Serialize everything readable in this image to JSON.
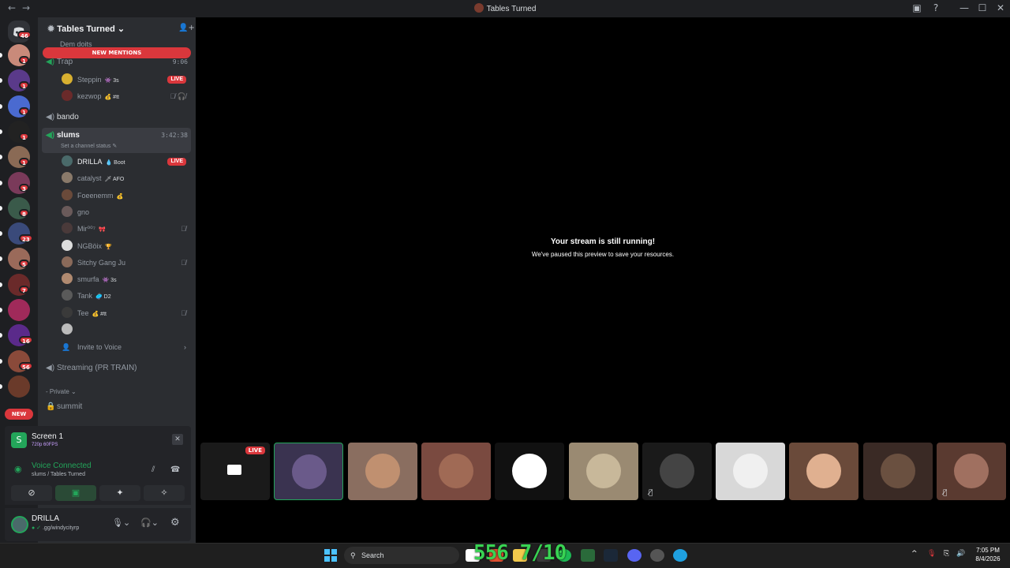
{
  "window": {
    "title": "Tables Turned",
    "back_glyph": "←",
    "forward_glyph": "→",
    "controls": [
      "▣",
      "?",
      "—",
      "☐",
      "✕"
    ]
  },
  "rail": {
    "home_badge": "46",
    "servers": [
      {
        "badge": "1",
        "color": "#c98a7a"
      },
      {
        "badge": "1",
        "color": "#5a3a8a"
      },
      {
        "badge": "1",
        "color": "#4a6ad0"
      },
      {
        "badge": "1",
        "color": "#222222"
      },
      {
        "badge": "1",
        "color": "#8a6a55"
      },
      {
        "badge": "3",
        "color": "#7a3a5a"
      },
      {
        "badge": "8",
        "color": "#3a5a4a"
      },
      {
        "badge": "23",
        "color": "#3a4a7a"
      },
      {
        "badge": "5",
        "color": "#9a6a5a"
      },
      {
        "badge": "7",
        "color": "#6a2a2a"
      },
      {
        "badge": "",
        "color": "#a02a5a"
      },
      {
        "badge": "16",
        "color": "#5a2a8a"
      },
      {
        "badge": "56",
        "color": "#8a4a3a"
      },
      {
        "badge": "",
        "color": "#6a3a2a"
      }
    ],
    "new_label": "NEW"
  },
  "guild": {
    "name": "Tables Turned",
    "chevron": "⌄",
    "invite_icon": "👤+",
    "new_mentions": "NEW MENTIONS"
  },
  "channels": {
    "dem_doits": "Dem doits",
    "trap": {
      "name": "Trap",
      "time": "9:06"
    },
    "trap_members": [
      {
        "name": "Steppin",
        "tag": "👾 3s",
        "live": "LIVE",
        "avatar": "#d8b030"
      },
      {
        "name": "kezwop",
        "tag": "💰 #tt",
        "mute": "🎙̸ 🎧̸",
        "avatar": "#6a2a2a"
      }
    ],
    "bando": "bando",
    "slums": {
      "name": "slums",
      "time": "3:42:38",
      "status": "Set a channel status ✎"
    },
    "slums_members": [
      {
        "name": "DRILLA",
        "tag": "💧 Boot",
        "live": "LIVE",
        "avatar": "#4a6a6a",
        "bright": true
      },
      {
        "name": "catalyst",
        "tag": "🗡 AFO",
        "avatar": "#8a7a6a"
      },
      {
        "name": "Foeenemm",
        "tag": "💰",
        "avatar": "#6a4a3a"
      },
      {
        "name": "gno",
        "tag": "",
        "avatar": "#6a5a5a"
      },
      {
        "name": "Mir⁰⁰⁷",
        "tag": "🎀",
        "mute": "🎙̸",
        "avatar": "#4a3a3a"
      },
      {
        "name": "NGBöix",
        "tag": "🏆",
        "avatar": "#dddddd"
      },
      {
        "name": "Sitchy Gang Ju",
        "tag": "",
        "mute": "🎙̸",
        "avatar": "#8a6a5a"
      },
      {
        "name": "smurfa",
        "tag": "👾 3s",
        "avatar": "#b08a70"
      },
      {
        "name": "Tank",
        "tag": "🥏 D2",
        "avatar": "#5a5a5a"
      },
      {
        "name": "Tee",
        "tag": "💰 #tt",
        "mute": "🎙̸",
        "avatar": "#3a3a3a"
      },
      {
        "name": "",
        "tag": "",
        "avatar": "#bbbbbb"
      }
    ],
    "invite_to_voice": "Invite to Voice",
    "invite_chevron": "›",
    "streaming": "Streaming (PR TRAIN)",
    "private_category": "- Private ⌄",
    "summit": "summit"
  },
  "screen_share": {
    "title": "Screen 1",
    "quality": "720p 60FPS",
    "stop_icon": "✕"
  },
  "voice": {
    "status": "Voice Connected",
    "location": "slums / Tables Turned"
  },
  "user": {
    "name": "DRILLA",
    "custom_status": ".gg/windycityrp"
  },
  "stage": {
    "paused_title": "Your stream is still running!",
    "paused_sub": "We've paused this preview to save your resources.",
    "tiles": [
      {
        "bg": "#1a1a1a",
        "circ": "",
        "live": "LIVE",
        "selected": false
      },
      {
        "bg": "#3a3350",
        "circ": "#6a5a8a",
        "selected": true
      },
      {
        "bg": "#8a6e60",
        "circ": "#c09070",
        "selected": false
      },
      {
        "bg": "#7a4a40",
        "circ": "#a06a55",
        "selected": false
      },
      {
        "bg": "#111111",
        "circ": "#ffffff",
        "selected": false
      },
      {
        "bg": "#9a8a72",
        "circ": "#c8b89a",
        "selected": false
      },
      {
        "bg": "#1a1a1a",
        "circ": "#444444",
        "mute": "🎙̸",
        "selected": false
      },
      {
        "bg": "#d8d8d8",
        "circ": "#f0f0f0",
        "selected": false
      },
      {
        "bg": "#6a4a3a",
        "circ": "#e0b090",
        "selected": false
      },
      {
        "bg": "#3a2a25",
        "circ": "#6a5040",
        "selected": false
      },
      {
        "bg": "#5a3a30",
        "circ": "#a07060",
        "mute": "🎙̸",
        "selected": false
      }
    ]
  },
  "taskbar": {
    "search": "Search",
    "overlay": "556 7/10",
    "time": "7:05 PM",
    "date": "8/4/2026",
    "tray": [
      "^",
      "🎙",
      "⎘",
      "🔊"
    ]
  }
}
